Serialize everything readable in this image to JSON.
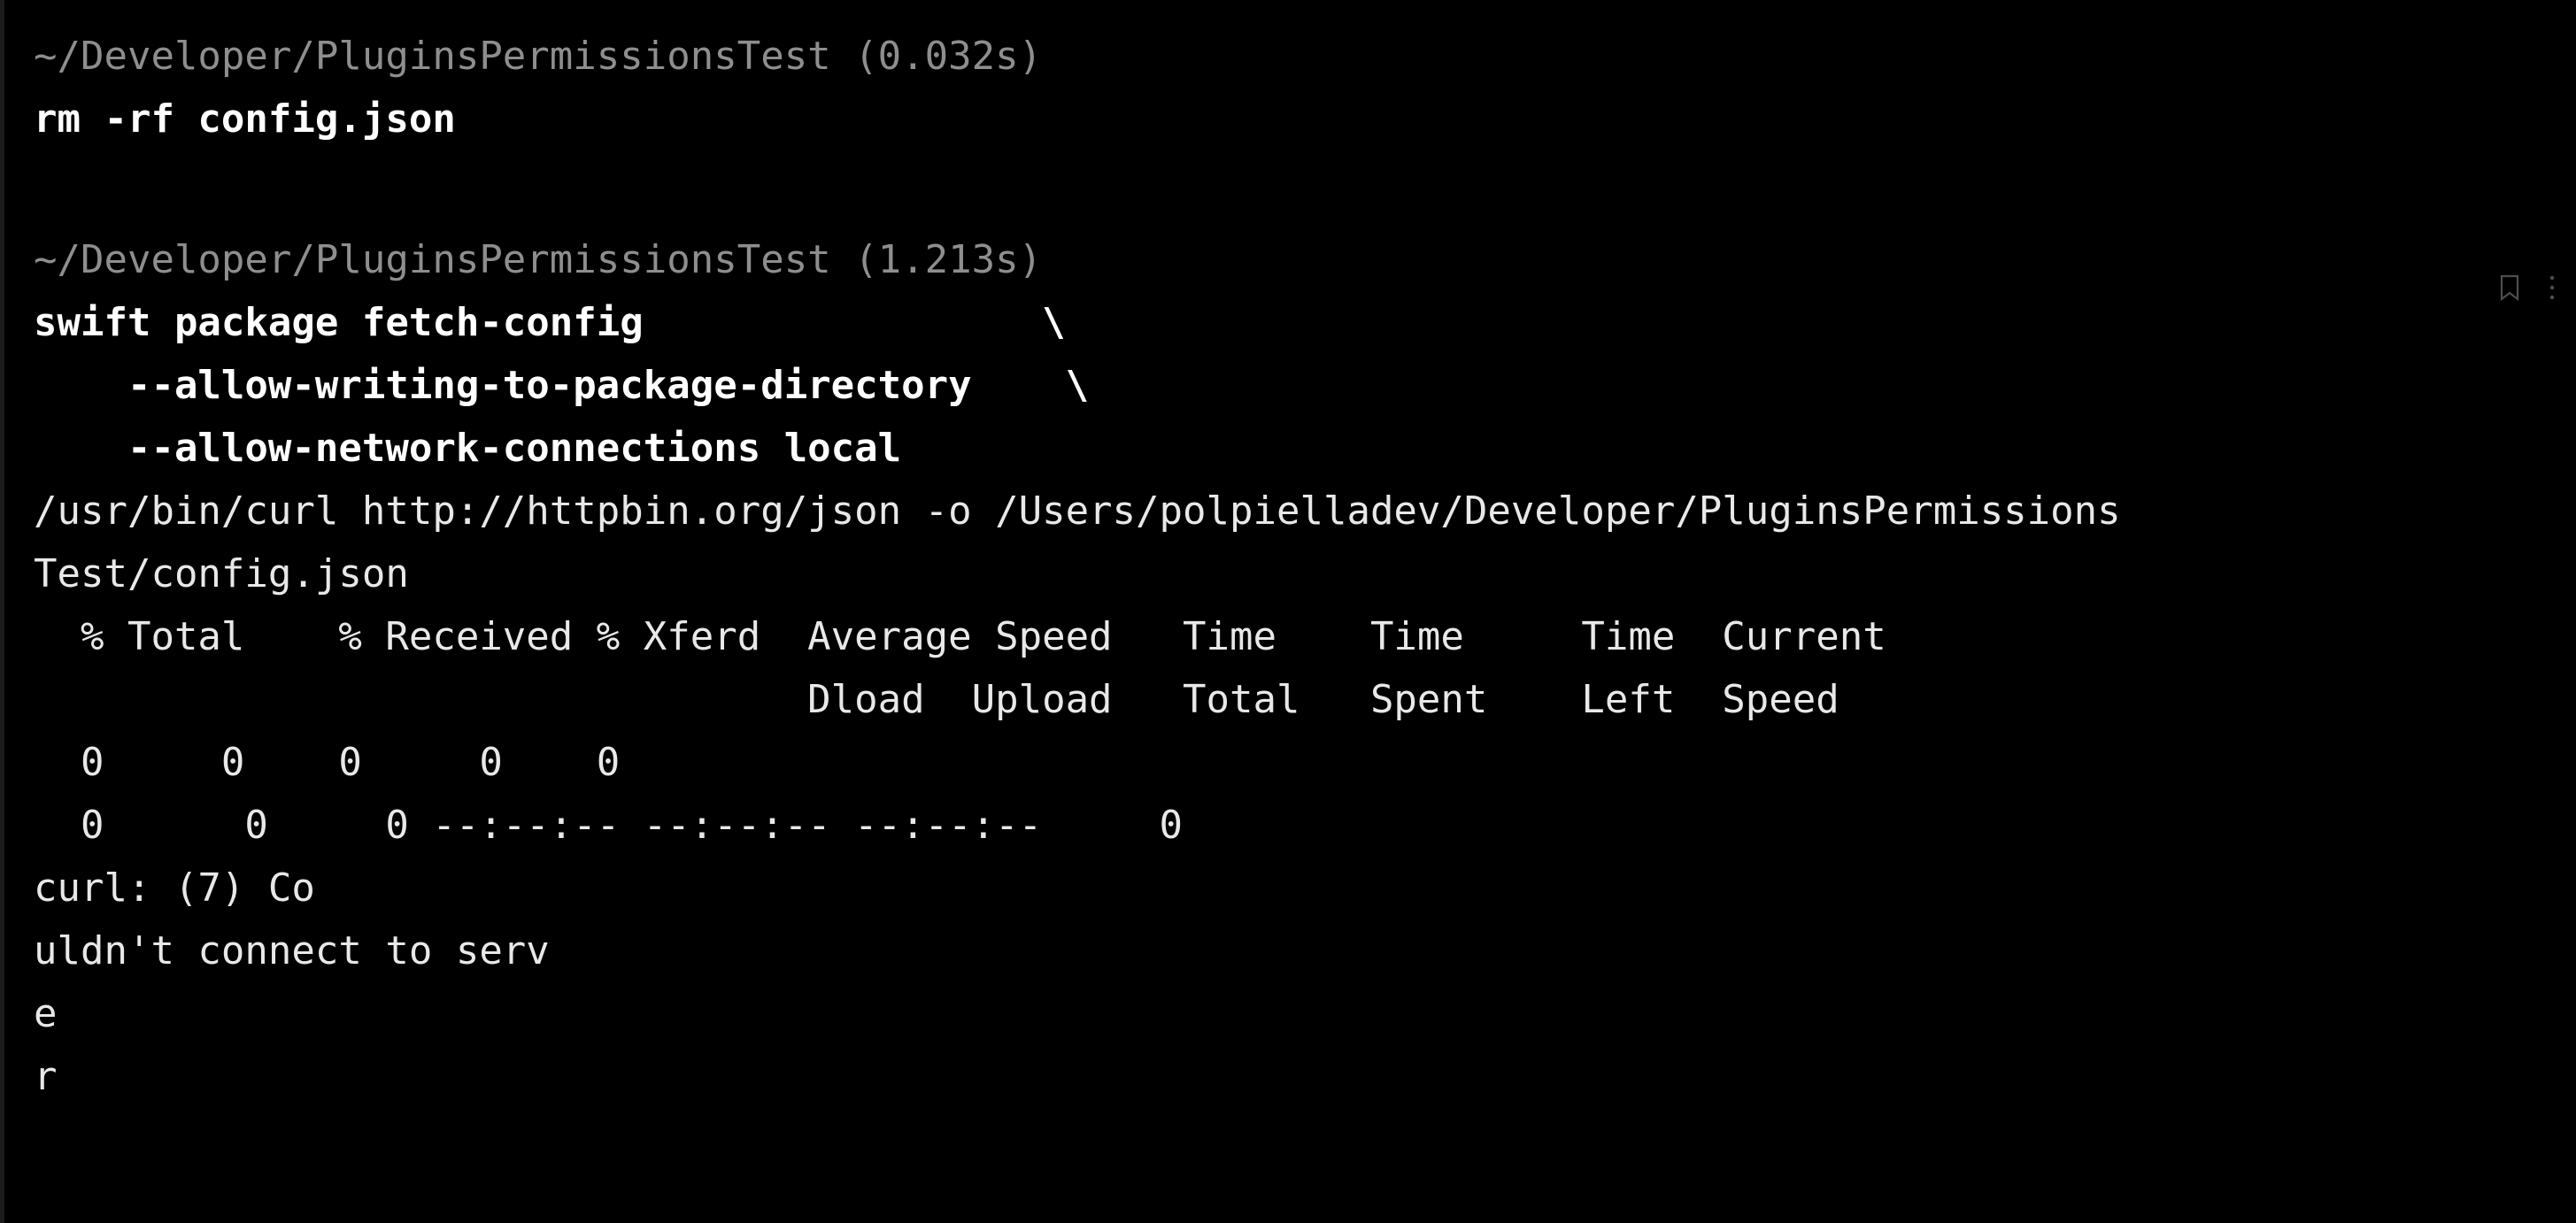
{
  "terminal": {
    "background_color": "#000000",
    "prompt_color": "#8e8e8e",
    "command_color": "#ffffff",
    "output_color": "#e8e8e8",
    "blocks": [
      {
        "prompt": "~/Developer/PluginsPermissionsTest (0.032s)",
        "command": "rm -rf config.json",
        "continuation_lines": [],
        "output": []
      },
      {
        "prompt": "~/Developer/PluginsPermissionsTest (1.213s)",
        "command": "swift package fetch-config                 \\",
        "continuation_lines": [
          "    --allow-writing-to-package-directory    \\",
          "    --allow-network-connections local"
        ],
        "output": [
          "/usr/bin/curl http://httpbin.org/json -o /Users/polpielladev/Developer/PluginsPermissions",
          "Test/config.json",
          "  % Total    % Received % Xferd  Average Speed   Time    Time     Time  Current",
          "                                 Dload  Upload   Total   Spent    Left  Speed",
          "  0     0    0     0    0",
          "  0      0     0 --:--:-- --:--:-- --:--:--     0",
          "curl: (7) Co",
          "uldn't connect to serv",
          "e",
          "r"
        ]
      }
    ]
  },
  "icons": {
    "bookmark": "bookmark-icon",
    "more": "more-options-icon"
  }
}
